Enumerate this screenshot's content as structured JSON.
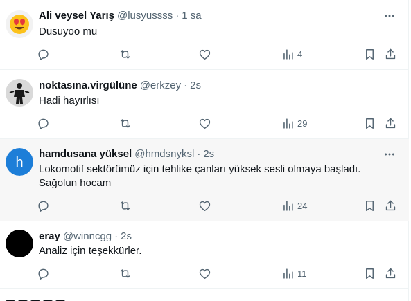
{
  "replies": [
    {
      "name": "Ali veysel Yarış",
      "handle": "@lusyussss",
      "dot": "·",
      "time": "1 sa",
      "text": "Dusuyoo mu",
      "views": "4",
      "avatar_icon": "heart-eyes-emoji"
    },
    {
      "name": "noktasına.virgülüne",
      "handle": "@erkzey",
      "dot": "·",
      "time": "2s",
      "text": "Hadi hayırlısı",
      "views": "29",
      "avatar_icon": "runner-photo"
    },
    {
      "name": "hamdusana yüksel",
      "handle": "@hmdsnyksl",
      "dot": "·",
      "time": "2s",
      "text": "Lokomotif sektörümüz için tehlike çanları yüksek sesli olmaya başladı. Sağolun hocam",
      "views": "24",
      "avatar_letter": "h",
      "avatar_color": "#1d7ed8"
    },
    {
      "name": "eray",
      "handle": "@winncgg",
      "dot": "·",
      "time": "2s",
      "text": "Analiz için teşekkürler.",
      "views": "11",
      "avatar_color": "#000000"
    }
  ],
  "colors": {
    "muted": "#536471",
    "text": "#0f1419",
    "border": "#eff3f4",
    "highlight": "#f7f7f7"
  }
}
